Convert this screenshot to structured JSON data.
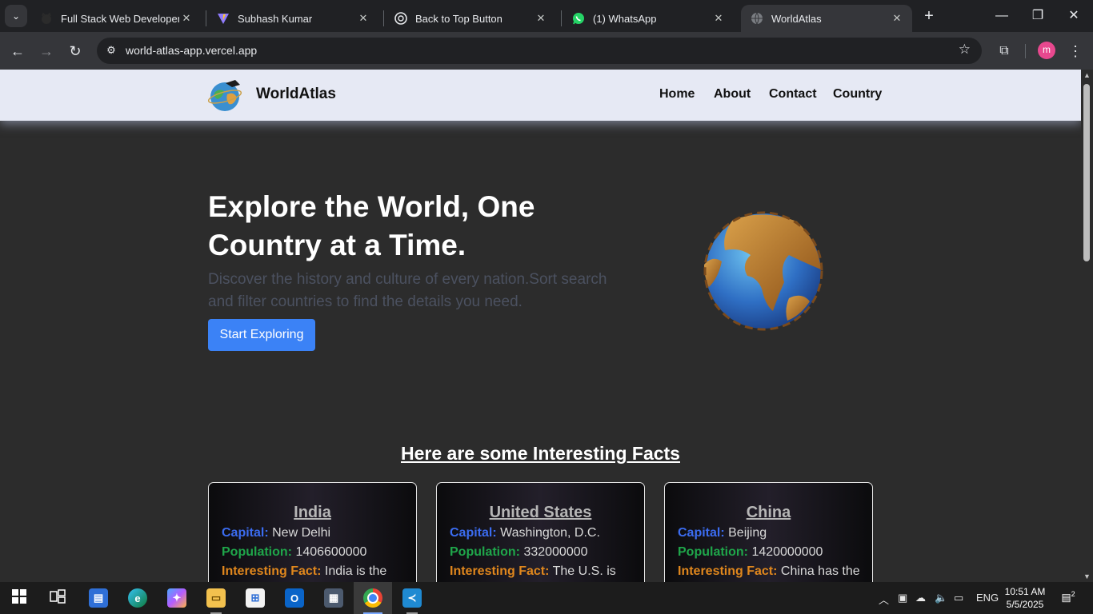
{
  "browser": {
    "tabs": [
      {
        "title": "Full Stack Web Developer",
        "icon": "octocat-icon",
        "active": false
      },
      {
        "title": "Subhash Kumar",
        "icon": "vite-icon",
        "active": false
      },
      {
        "title": "Back to Top Button",
        "icon": "chatgpt-icon",
        "active": false
      },
      {
        "title": "(1) WhatsApp",
        "icon": "whatsapp-icon",
        "active": false
      },
      {
        "title": "WorldAtlas",
        "icon": "globe-icon",
        "active": true
      }
    ],
    "url": "world-atlas-app.vercel.app",
    "profile_initial": "m"
  },
  "site": {
    "brand": "WorldAtlas",
    "nav": [
      "Home",
      "About",
      "Contact",
      "Country"
    ],
    "hero": {
      "title": "Explore the World, One Country at a Time.",
      "subtitle": "Discover the history and culture of every nation.Sort search and filter countries to find the details you need.",
      "cta": "Start Exploring"
    },
    "facts": {
      "title": "Here are some Interesting Facts",
      "labels": {
        "capital": "Capital:",
        "population": "Population:",
        "fact": "Interesting Fact:"
      },
      "cards": [
        {
          "country": "India",
          "capital": "New Delhi",
          "population": "1406600000",
          "fact": "India is the"
        },
        {
          "country": "United States",
          "capital": "Washington, D.C.",
          "population": "332000000",
          "fact": "The U.S. is"
        },
        {
          "country": "China",
          "capital": "Beijing",
          "population": "1420000000",
          "fact": "China has the"
        }
      ]
    }
  },
  "taskbar": {
    "apps": [
      "start-icon",
      "task-view-icon",
      "widgets-icon",
      "edge-icon",
      "copilot-icon",
      "file-explorer-icon",
      "store-icon",
      "outlook-icon",
      "calculator-icon",
      "chrome-icon",
      "vscode-icon"
    ],
    "language": "ENG",
    "time": "10:51 AM",
    "date": "5/5/2025",
    "notifications": "2"
  },
  "colors": {
    "accent_button": "#3b82f6",
    "header_bg": "#e6e9f4",
    "page_bg": "#2c2c2c",
    "capital_label": "#3b6cf0",
    "population_label": "#1fa64a",
    "fact_label": "#e0871d"
  }
}
